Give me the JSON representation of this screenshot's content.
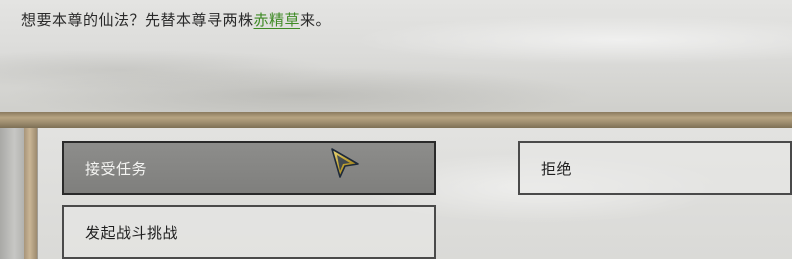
{
  "dialog": {
    "text_before": "想要本尊的仙法？先替本尊寻两株",
    "highlight": "赤精草",
    "text_after": "来。",
    "highlight_color": "#3e8a24"
  },
  "options": {
    "accept": "接受任务",
    "refuse": "拒绝",
    "battle": "发起战斗挑战"
  },
  "cursor": {
    "icon": "arrow-cursor-icon",
    "color": "#b99a2c"
  }
}
